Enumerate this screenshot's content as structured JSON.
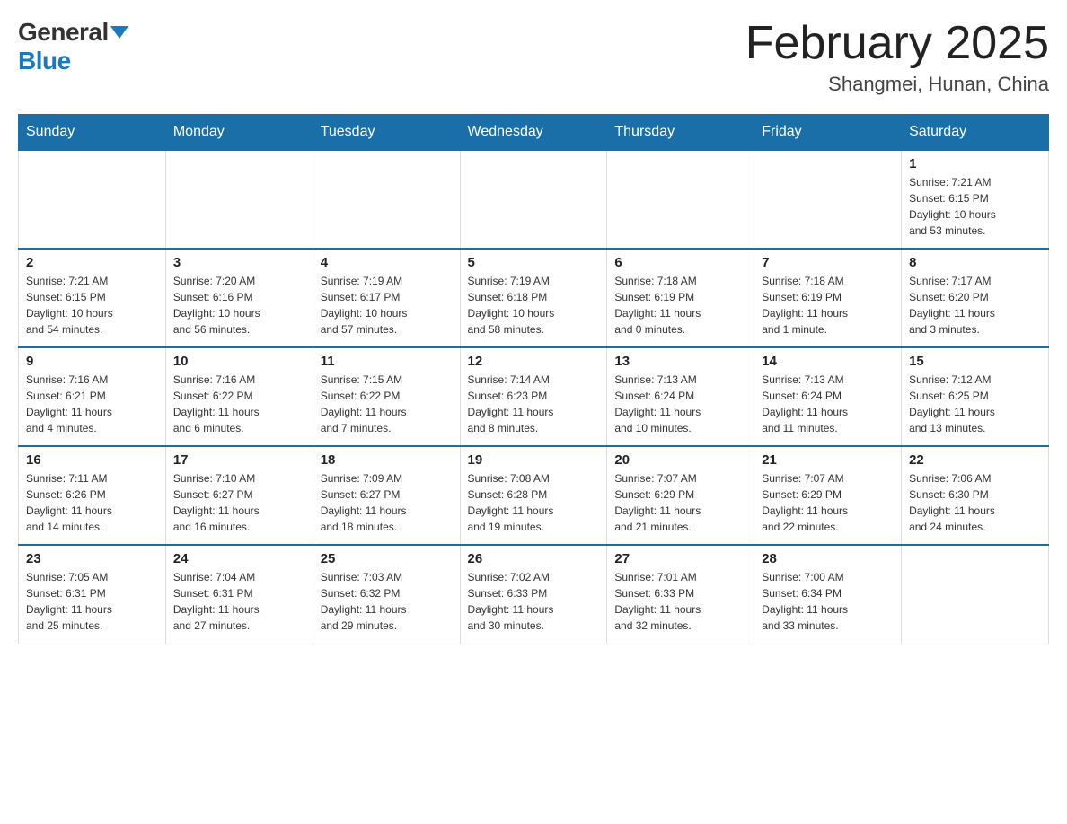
{
  "header": {
    "logo_general": "General",
    "logo_blue": "Blue",
    "month_year": "February 2025",
    "location": "Shangmei, Hunan, China"
  },
  "days_of_week": [
    "Sunday",
    "Monday",
    "Tuesday",
    "Wednesday",
    "Thursday",
    "Friday",
    "Saturday"
  ],
  "weeks": [
    [
      {
        "day": "",
        "info": ""
      },
      {
        "day": "",
        "info": ""
      },
      {
        "day": "",
        "info": ""
      },
      {
        "day": "",
        "info": ""
      },
      {
        "day": "",
        "info": ""
      },
      {
        "day": "",
        "info": ""
      },
      {
        "day": "1",
        "info": "Sunrise: 7:21 AM\nSunset: 6:15 PM\nDaylight: 10 hours\nand 53 minutes."
      }
    ],
    [
      {
        "day": "2",
        "info": "Sunrise: 7:21 AM\nSunset: 6:15 PM\nDaylight: 10 hours\nand 54 minutes."
      },
      {
        "day": "3",
        "info": "Sunrise: 7:20 AM\nSunset: 6:16 PM\nDaylight: 10 hours\nand 56 minutes."
      },
      {
        "day": "4",
        "info": "Sunrise: 7:19 AM\nSunset: 6:17 PM\nDaylight: 10 hours\nand 57 minutes."
      },
      {
        "day": "5",
        "info": "Sunrise: 7:19 AM\nSunset: 6:18 PM\nDaylight: 10 hours\nand 58 minutes."
      },
      {
        "day": "6",
        "info": "Sunrise: 7:18 AM\nSunset: 6:19 PM\nDaylight: 11 hours\nand 0 minutes."
      },
      {
        "day": "7",
        "info": "Sunrise: 7:18 AM\nSunset: 6:19 PM\nDaylight: 11 hours\nand 1 minute."
      },
      {
        "day": "8",
        "info": "Sunrise: 7:17 AM\nSunset: 6:20 PM\nDaylight: 11 hours\nand 3 minutes."
      }
    ],
    [
      {
        "day": "9",
        "info": "Sunrise: 7:16 AM\nSunset: 6:21 PM\nDaylight: 11 hours\nand 4 minutes."
      },
      {
        "day": "10",
        "info": "Sunrise: 7:16 AM\nSunset: 6:22 PM\nDaylight: 11 hours\nand 6 minutes."
      },
      {
        "day": "11",
        "info": "Sunrise: 7:15 AM\nSunset: 6:22 PM\nDaylight: 11 hours\nand 7 minutes."
      },
      {
        "day": "12",
        "info": "Sunrise: 7:14 AM\nSunset: 6:23 PM\nDaylight: 11 hours\nand 8 minutes."
      },
      {
        "day": "13",
        "info": "Sunrise: 7:13 AM\nSunset: 6:24 PM\nDaylight: 11 hours\nand 10 minutes."
      },
      {
        "day": "14",
        "info": "Sunrise: 7:13 AM\nSunset: 6:24 PM\nDaylight: 11 hours\nand 11 minutes."
      },
      {
        "day": "15",
        "info": "Sunrise: 7:12 AM\nSunset: 6:25 PM\nDaylight: 11 hours\nand 13 minutes."
      }
    ],
    [
      {
        "day": "16",
        "info": "Sunrise: 7:11 AM\nSunset: 6:26 PM\nDaylight: 11 hours\nand 14 minutes."
      },
      {
        "day": "17",
        "info": "Sunrise: 7:10 AM\nSunset: 6:27 PM\nDaylight: 11 hours\nand 16 minutes."
      },
      {
        "day": "18",
        "info": "Sunrise: 7:09 AM\nSunset: 6:27 PM\nDaylight: 11 hours\nand 18 minutes."
      },
      {
        "day": "19",
        "info": "Sunrise: 7:08 AM\nSunset: 6:28 PM\nDaylight: 11 hours\nand 19 minutes."
      },
      {
        "day": "20",
        "info": "Sunrise: 7:07 AM\nSunset: 6:29 PM\nDaylight: 11 hours\nand 21 minutes."
      },
      {
        "day": "21",
        "info": "Sunrise: 7:07 AM\nSunset: 6:29 PM\nDaylight: 11 hours\nand 22 minutes."
      },
      {
        "day": "22",
        "info": "Sunrise: 7:06 AM\nSunset: 6:30 PM\nDaylight: 11 hours\nand 24 minutes."
      }
    ],
    [
      {
        "day": "23",
        "info": "Sunrise: 7:05 AM\nSunset: 6:31 PM\nDaylight: 11 hours\nand 25 minutes."
      },
      {
        "day": "24",
        "info": "Sunrise: 7:04 AM\nSunset: 6:31 PM\nDaylight: 11 hours\nand 27 minutes."
      },
      {
        "day": "25",
        "info": "Sunrise: 7:03 AM\nSunset: 6:32 PM\nDaylight: 11 hours\nand 29 minutes."
      },
      {
        "day": "26",
        "info": "Sunrise: 7:02 AM\nSunset: 6:33 PM\nDaylight: 11 hours\nand 30 minutes."
      },
      {
        "day": "27",
        "info": "Sunrise: 7:01 AM\nSunset: 6:33 PM\nDaylight: 11 hours\nand 32 minutes."
      },
      {
        "day": "28",
        "info": "Sunrise: 7:00 AM\nSunset: 6:34 PM\nDaylight: 11 hours\nand 33 minutes."
      },
      {
        "day": "",
        "info": ""
      }
    ]
  ]
}
